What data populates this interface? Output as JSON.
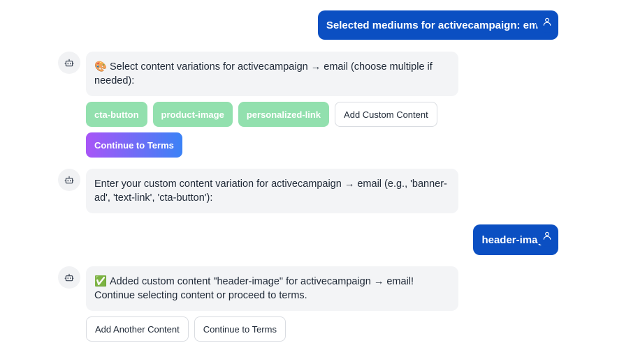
{
  "messages": {
    "user1": {
      "text": "Selected mediums for activecampaign: email"
    },
    "bot1": {
      "emoji": "🎨",
      "text": "Select content variations for activecampaign → email (choose multiple if needed):"
    },
    "chips1": [
      "cta-button",
      "product-image",
      "personalized-link"
    ],
    "add_custom_label": "Add Custom Content",
    "continue_primary_label": "Continue to Terms",
    "bot2": {
      "text": "Enter your custom content variation for activecampaign → email (e.g., 'banner-ad', 'text-link', 'cta-button'):"
    },
    "user2": {
      "text": "header-image"
    },
    "bot3": {
      "emoji": "✅",
      "text": "Added custom content \"header-image\" for activecampaign → email! Continue selecting content or proceed to terms."
    },
    "add_another_label": "Add Another Content",
    "continue_secondary_label": "Continue to Terms"
  },
  "icons": {
    "user_avatar": "user-icon",
    "bot_avatar": "bot-icon"
  },
  "colors": {
    "user_bubble": "#0b4fc2",
    "bot_bubble": "#f3f4f6",
    "chip_selected": "#92e0ae",
    "gradient_start": "#a855f7",
    "gradient_end": "#3b82f6"
  }
}
